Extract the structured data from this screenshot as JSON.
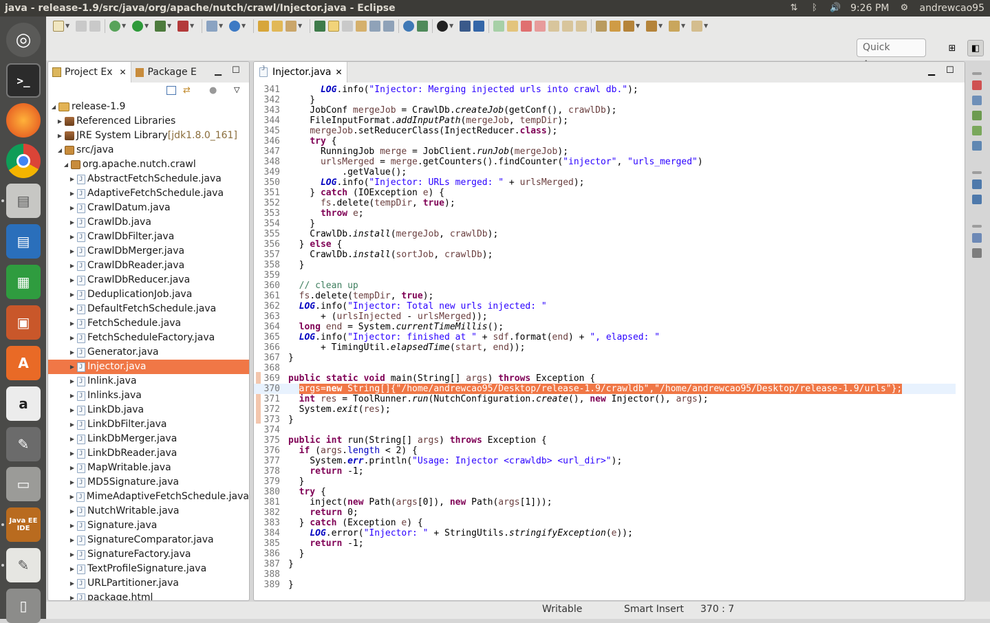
{
  "window": {
    "title": "java - release-1.9/src/java/org/apache/nutch/crawl/Injector.java - Eclipse"
  },
  "top_panel": {
    "time": "9:26 PM",
    "user": "andrewcao95"
  },
  "quick_access": {
    "placeholder": "Quick Access"
  },
  "explorer": {
    "tabs": [
      "Project Ex",
      "Package E"
    ],
    "tree": [
      {
        "label": "release-1.9",
        "indent": 0,
        "type": "project",
        "expanded": true
      },
      {
        "label": "Referenced Libraries",
        "indent": 1,
        "type": "lib",
        "expanded": false
      },
      {
        "label": "JRE System Library",
        "suffix": " [jdk1.8.0_161]",
        "indent": 1,
        "type": "lib",
        "expanded": false
      },
      {
        "label": "src/java",
        "indent": 1,
        "type": "pkg",
        "expanded": true
      },
      {
        "label": "org.apache.nutch.crawl",
        "indent": 2,
        "type": "pkg",
        "expanded": true
      },
      {
        "label": "AbstractFetchSchedule.java",
        "indent": 3,
        "type": "file"
      },
      {
        "label": "AdaptiveFetchSchedule.java",
        "indent": 3,
        "type": "file"
      },
      {
        "label": "CrawlDatum.java",
        "indent": 3,
        "type": "file"
      },
      {
        "label": "CrawlDb.java",
        "indent": 3,
        "type": "file"
      },
      {
        "label": "CrawlDbFilter.java",
        "indent": 3,
        "type": "file"
      },
      {
        "label": "CrawlDbMerger.java",
        "indent": 3,
        "type": "file"
      },
      {
        "label": "CrawlDbReader.java",
        "indent": 3,
        "type": "file"
      },
      {
        "label": "CrawlDbReducer.java",
        "indent": 3,
        "type": "file"
      },
      {
        "label": "DeduplicationJob.java",
        "indent": 3,
        "type": "file"
      },
      {
        "label": "DefaultFetchSchedule.java",
        "indent": 3,
        "type": "file"
      },
      {
        "label": "FetchSchedule.java",
        "indent": 3,
        "type": "file"
      },
      {
        "label": "FetchScheduleFactory.java",
        "indent": 3,
        "type": "file"
      },
      {
        "label": "Generator.java",
        "indent": 3,
        "type": "file"
      },
      {
        "label": "Injector.java",
        "indent": 3,
        "type": "file",
        "selected": true
      },
      {
        "label": "Inlink.java",
        "indent": 3,
        "type": "file"
      },
      {
        "label": "Inlinks.java",
        "indent": 3,
        "type": "file"
      },
      {
        "label": "LinkDb.java",
        "indent": 3,
        "type": "file"
      },
      {
        "label": "LinkDbFilter.java",
        "indent": 3,
        "type": "file"
      },
      {
        "label": "LinkDbMerger.java",
        "indent": 3,
        "type": "file"
      },
      {
        "label": "LinkDbReader.java",
        "indent": 3,
        "type": "file"
      },
      {
        "label": "MapWritable.java",
        "indent": 3,
        "type": "file"
      },
      {
        "label": "MD5Signature.java",
        "indent": 3,
        "type": "file"
      },
      {
        "label": "MimeAdaptiveFetchSchedule.java",
        "indent": 3,
        "type": "file"
      },
      {
        "label": "NutchWritable.java",
        "indent": 3,
        "type": "file"
      },
      {
        "label": "Signature.java",
        "indent": 3,
        "type": "file"
      },
      {
        "label": "SignatureComparator.java",
        "indent": 3,
        "type": "file"
      },
      {
        "label": "SignatureFactory.java",
        "indent": 3,
        "type": "file"
      },
      {
        "label": "TextProfileSignature.java",
        "indent": 3,
        "type": "file"
      },
      {
        "label": "URLPartitioner.java",
        "indent": 3,
        "type": "file"
      },
      {
        "label": "package.html",
        "indent": 3,
        "type": "file"
      }
    ]
  },
  "editor": {
    "tab_label": "Injector.java",
    "current_line": 370,
    "lines": [
      {
        "n": "341",
        "html": "      <span class=\"fld\">LOG</span>.info(<span class=\"str\">\"Injector: Merging injected urls into crawl db.\"</span>);"
      },
      {
        "n": "342",
        "html": "    }"
      },
      {
        "n": "343",
        "html": "    JobConf <span class=\"var\">mergeJob</span> = CrawlDb.<span class=\"it\">createJob</span>(getConf(), <span class=\"var\">crawlDb</span>);"
      },
      {
        "n": "344",
        "html": "    FileInputFormat.<span class=\"it\">addInputPath</span>(<span class=\"var\">mergeJob</span>, <span class=\"var\">tempDir</span>);"
      },
      {
        "n": "345",
        "html": "    <span class=\"var\">mergeJob</span>.setReducerClass(InjectReducer.<span class=\"kw\">class</span>);"
      },
      {
        "n": "346",
        "html": "    <span class=\"kw\">try</span> {"
      },
      {
        "n": "347",
        "html": "      RunningJob <span class=\"var\">merge</span> = JobClient.<span class=\"it\">runJob</span>(<span class=\"var\">mergeJob</span>);"
      },
      {
        "n": "348",
        "html": "      <span class=\"var\">urlsMerged</span> = <span class=\"var\">merge</span>.getCounters().findCounter(<span class=\"str\">\"injector\"</span>, <span class=\"str\">\"urls_merged\"</span>)"
      },
      {
        "n": "349",
        "html": "          .getValue();"
      },
      {
        "n": "350",
        "html": "      <span class=\"fld\">LOG</span>.info(<span class=\"str\">\"Injector: URLs merged: \"</span> + <span class=\"var\">urlsMerged</span>);"
      },
      {
        "n": "351",
        "html": "    } <span class=\"kw\">catch</span> (IOException <span class=\"var\">e</span>) {"
      },
      {
        "n": "352",
        "html": "      <span class=\"var\">fs</span>.delete(<span class=\"var\">tempDir</span>, <span class=\"kw\">true</span>);"
      },
      {
        "n": "353",
        "html": "      <span class=\"kw\">throw</span> <span class=\"var\">e</span>;"
      },
      {
        "n": "354",
        "html": "    }"
      },
      {
        "n": "355",
        "html": "    CrawlDb.<span class=\"it\">install</span>(<span class=\"var\">mergeJob</span>, <span class=\"var\">crawlDb</span>);"
      },
      {
        "n": "356",
        "html": "  } <span class=\"kw\">else</span> {"
      },
      {
        "n": "357",
        "html": "    CrawlDb.<span class=\"it\">install</span>(<span class=\"var\">sortJob</span>, <span class=\"var\">crawlDb</span>);"
      },
      {
        "n": "358",
        "html": "  }"
      },
      {
        "n": "359",
        "html": ""
      },
      {
        "n": "360",
        "html": "  <span class=\"cm\">// clean up</span>"
      },
      {
        "n": "361",
        "html": "  <span class=\"var\">fs</span>.delete(<span class=\"var\">tempDir</span>, <span class=\"kw\">true</span>);"
      },
      {
        "n": "362",
        "html": "  <span class=\"fld\">LOG</span>.info(<span class=\"str\">\"Injector: Total new urls injected: \"</span>"
      },
      {
        "n": "363",
        "html": "      + (<span class=\"var\">urlsInjected</span> - <span class=\"var\">urlsMerged</span>));"
      },
      {
        "n": "364",
        "html": "  <span class=\"kw\">long</span> <span class=\"var\">end</span> = System.<span class=\"it\">currentTimeMillis</span>();"
      },
      {
        "n": "365",
        "html": "  <span class=\"fld\">LOG</span>.info(<span class=\"str\">\"Injector: finished at \"</span> + <span class=\"var\">sdf</span>.format(<span class=\"var\">end</span>) + <span class=\"str\">\", elapsed: \"</span>"
      },
      {
        "n": "366",
        "html": "      + TimingUtil.<span class=\"it\">elapsedTime</span>(<span class=\"var\">start</span>, <span class=\"var\">end</span>));"
      },
      {
        "n": "367",
        "html": "}"
      },
      {
        "n": "368",
        "html": ""
      },
      {
        "n": "369",
        "html": "<span class=\"kw\">public static void</span> main(String[] <span class=\"var\">args</span>) <span class=\"kw\">throws</span> Exception {"
      },
      {
        "n": "370",
        "html": "  <span class=\"sel\">args=<span class=\"kw\">new</span> String[]{\"/home/andrewcao95/Desktop/release-1.9/crawldb\",\"/home/andrewcao95/Desktop/release-1.9/urls\"};</span>"
      },
      {
        "n": "371",
        "html": "  <span class=\"kw\">int</span> <span class=\"var\">res</span> = ToolRunner.<span class=\"it\">run</span>(NutchConfiguration.<span class=\"it\">create</span>(), <span class=\"kw\">new</span> Injector(), <span class=\"var\">args</span>);"
      },
      {
        "n": "372",
        "html": "  System.<span class=\"it\">exit</span>(<span class=\"var\">res</span>);"
      },
      {
        "n": "373",
        "html": "}"
      },
      {
        "n": "374",
        "html": ""
      },
      {
        "n": "375",
        "html": "<span class=\"kw\">public int</span> run(String[] <span class=\"var\">args</span>) <span class=\"kw\">throws</span> Exception {"
      },
      {
        "n": "376",
        "html": "  <span class=\"kw\">if</span> (<span class=\"var\">args</span>.<span class=\"fld\" style=\"font-style:normal;font-weight:normal\">length</span> &lt; 2) {"
      },
      {
        "n": "377",
        "html": "    System.<span class=\"fld\">err</span>.println(<span class=\"str\">\"Usage: Injector &lt;crawldb&gt; &lt;url_dir&gt;\"</span>);"
      },
      {
        "n": "378",
        "html": "    <span class=\"kw\">return</span> -1;"
      },
      {
        "n": "379",
        "html": "  }"
      },
      {
        "n": "380",
        "html": "  <span class=\"kw\">try</span> {"
      },
      {
        "n": "381",
        "html": "    inject(<span class=\"kw\">new</span> Path(<span class=\"var\">args</span>[0]), <span class=\"kw\">new</span> Path(<span class=\"var\">args</span>[1]));"
      },
      {
        "n": "382",
        "html": "    <span class=\"kw\">return</span> 0;"
      },
      {
        "n": "383",
        "html": "  } <span class=\"kw\">catch</span> (Exception <span class=\"var\">e</span>) {"
      },
      {
        "n": "384",
        "html": "    <span class=\"fld\">LOG</span>.error(<span class=\"str\">\"Injector: \"</span> + StringUtils.<span class=\"it\">stringifyException</span>(<span class=\"var\">e</span>));"
      },
      {
        "n": "385",
        "html": "    <span class=\"kw\">return</span> -1;"
      },
      {
        "n": "386",
        "html": "  }"
      },
      {
        "n": "387",
        "html": "}"
      },
      {
        "n": "388",
        "html": ""
      },
      {
        "n": "389",
        "html": "}"
      }
    ]
  },
  "status": {
    "mode": "Writable",
    "insert": "Smart Insert",
    "position": "370 : 7"
  },
  "colors": {
    "selection": "#f07746",
    "keyword": "#7f0055",
    "string": "#2a00ff",
    "comment": "#3f7f5f"
  }
}
